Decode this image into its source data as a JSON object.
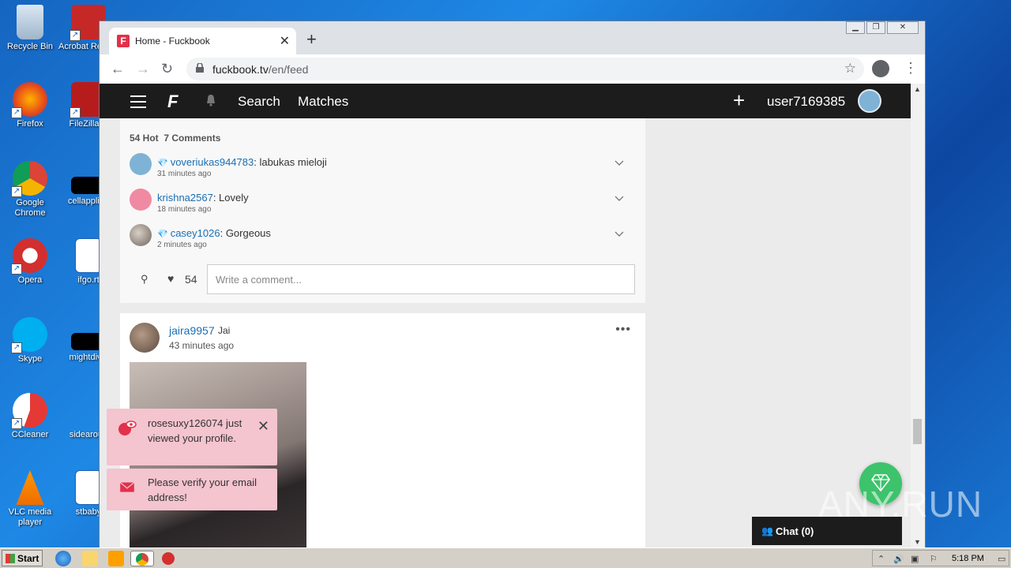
{
  "desktop": {
    "icons": [
      {
        "label": "Recycle Bin",
        "name": "recycle-bin-icon"
      },
      {
        "label": "Acrobat Reader",
        "name": "acrobat-reader-icon"
      },
      {
        "label": "Firefox",
        "name": "firefox-icon"
      },
      {
        "label": "FileZilla C",
        "name": "filezilla-icon"
      },
      {
        "label": "Google Chrome",
        "name": "chrome-icon"
      },
      {
        "label": "cellapplied",
        "name": "file-icon"
      },
      {
        "label": "Opera",
        "name": "opera-icon"
      },
      {
        "label": "ifgo.rt",
        "name": "word-doc-icon"
      },
      {
        "label": "Skype",
        "name": "skype-icon"
      },
      {
        "label": "mightdivis",
        "name": "file-icon"
      },
      {
        "label": "CCleaner",
        "name": "ccleaner-icon"
      },
      {
        "label": "sidearoun",
        "name": "file-icon"
      },
      {
        "label": "VLC media player",
        "name": "vlc-icon"
      },
      {
        "label": "stbaby",
        "name": "word-doc-icon"
      }
    ]
  },
  "browser": {
    "tab_title": "Home - Fuckbook",
    "favicon_letter": "F",
    "url_host": "fuckbook.tv",
    "url_path": "/en/feed"
  },
  "site": {
    "logo": "F",
    "nav_search": "Search",
    "nav_matches": "Matches",
    "username": "user7169385"
  },
  "post1": {
    "hot": "54 Hot",
    "comments_count": "7 Comments",
    "comments": [
      {
        "user": "voveriukas944783",
        "text": ": labukas mieloji",
        "time": "31 minutes ago",
        "gem": true,
        "avatar_color": "#7fb3d5"
      },
      {
        "user": "krishna2567",
        "text": ": Lovely",
        "time": "18 minutes ago",
        "gem": false,
        "avatar_color": "#f08aa3"
      },
      {
        "user": "casey1026",
        "text": ": Gorgeous",
        "time": "2 minutes ago",
        "gem": true,
        "avatar_color": "#8a7c72"
      }
    ],
    "likes": "54",
    "comment_placeholder": "Write a comment..."
  },
  "post2": {
    "username": "jaira9957",
    "short_text": "Jai",
    "time": "43 minutes ago"
  },
  "toasts": {
    "viewed": "rosesuxy126074 just viewed your profile.",
    "verify": "Please verify your email address!"
  },
  "chat": {
    "label": "Chat (0)"
  },
  "watermark": "ANY.RUN",
  "taskbar": {
    "start": "Start",
    "clock": "5:18 PM"
  },
  "colors": {
    "accent_link": "#1a6fb3",
    "brand_red": "#e2314a",
    "toast_pink": "#f4c4cf",
    "fab_green": "#3cc36b"
  }
}
